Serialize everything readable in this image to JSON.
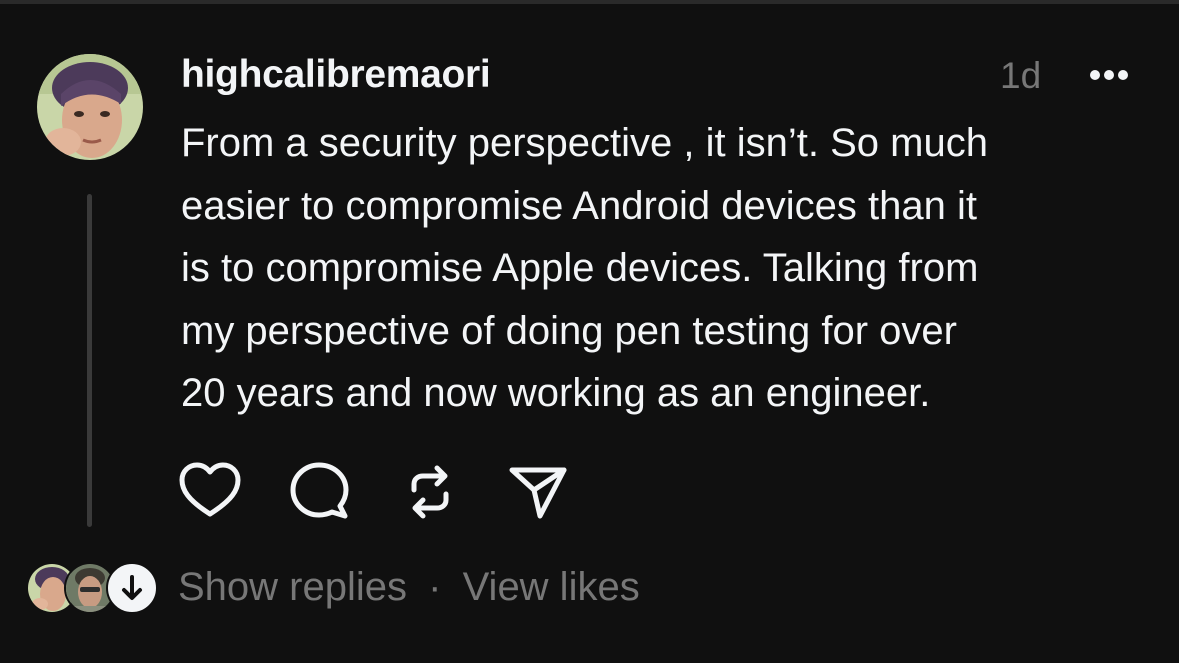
{
  "post": {
    "username": "highcalibremaori",
    "timestamp": "1d",
    "text_lines": [
      "From a security perspective , it isn’t. So much",
      "easier to compromise Android devices than it",
      "is to compromise Apple devices. Talking from",
      "my perspective of doing pen testing for over",
      "20 years and now working as an engineer."
    ],
    "actions": [
      {
        "name": "like",
        "icon": "heart-icon"
      },
      {
        "name": "reply",
        "icon": "comment-icon"
      },
      {
        "name": "repost",
        "icon": "repost-icon"
      },
      {
        "name": "share",
        "icon": "send-icon"
      }
    ],
    "more_icon": "more-horizontal-icon"
  },
  "footer": {
    "show_replies": "Show replies",
    "separator": "·",
    "view_likes": "View likes",
    "expand_icon": "arrow-down-icon"
  },
  "colors": {
    "background": "#101010",
    "primary_text": "#f3f5f7",
    "secondary_text": "#777777",
    "thread_line": "#3a3a3a"
  }
}
